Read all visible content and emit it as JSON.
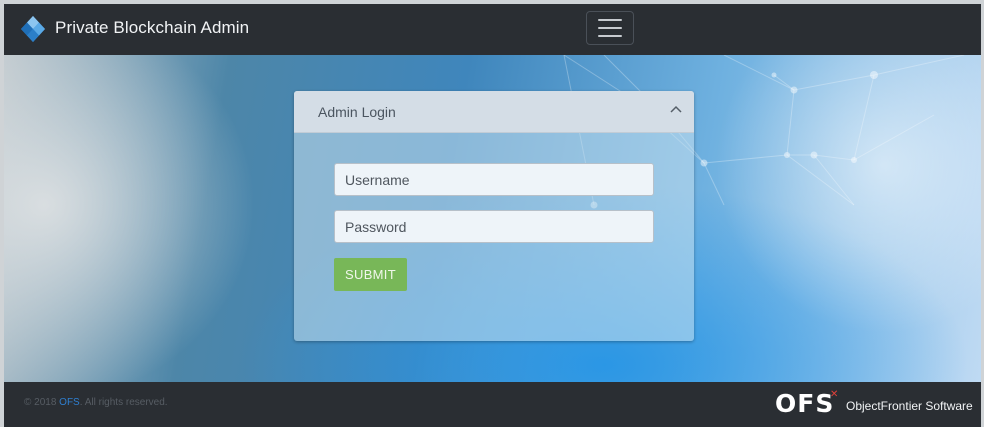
{
  "navbar": {
    "title": "Private Blockchain Admin",
    "logo_icon": "blockchain-cube-logo",
    "menu_icon": "hamburger-icon"
  },
  "login_card": {
    "header_title": "Admin Login",
    "collapse_icon": "chevron-up-icon",
    "username": {
      "placeholder": "Username",
      "value": ""
    },
    "password": {
      "placeholder": "Password",
      "value": ""
    },
    "submit_label": "SUBMIT"
  },
  "footer": {
    "copyright_prefix": "© 2018 ",
    "brand_link": "OFS",
    "copyright_suffix": ". All rights reserved.",
    "company_logo_text": "OFS",
    "company_name": "ObjectFrontier Software"
  },
  "colors": {
    "navbar_bg": "#2a2e33",
    "submit_green": "#78b758",
    "link_blue": "#2f7fd0",
    "logo_accent_red": "#e0403a"
  }
}
